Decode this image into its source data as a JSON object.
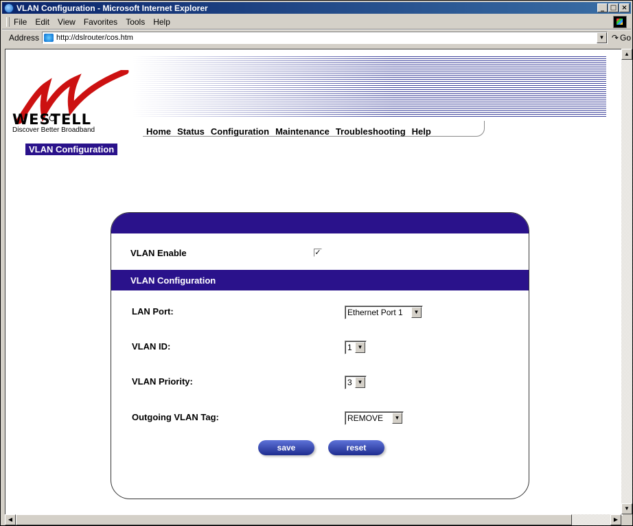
{
  "window": {
    "title": "VLAN Configuration - Microsoft Internet Explorer"
  },
  "menu": {
    "items": [
      "File",
      "Edit",
      "View",
      "Favorites",
      "Tools",
      "Help"
    ]
  },
  "address": {
    "label": "Address",
    "url": "http://dslrouter/cos.htm",
    "go": "Go"
  },
  "brand": {
    "name": "WESTELL",
    "tagline": "Discover Better Broadband"
  },
  "nav": {
    "items": [
      "Home",
      "Status",
      "Configuration",
      "Maintenance",
      "Troubleshooting",
      "Help"
    ]
  },
  "page": {
    "label": "VLAN Configuration"
  },
  "form": {
    "vlan_enable": {
      "label": "VLAN Enable",
      "checked": true
    },
    "section_title": "VLAN Configuration",
    "lan_port": {
      "label": "LAN Port:",
      "value": "Ethernet Port 1"
    },
    "vlan_id": {
      "label": "VLAN ID:",
      "value": "1"
    },
    "vlan_priority": {
      "label": "VLAN Priority:",
      "value": "3"
    },
    "outgoing_tag": {
      "label": "Outgoing VLAN Tag:",
      "value": "REMOVE"
    },
    "save_label": "save",
    "reset_label": "reset"
  },
  "colors": {
    "brand_purple": "#2a128b",
    "logo_red": "#cc1111",
    "titlebar": "#0a246a"
  }
}
